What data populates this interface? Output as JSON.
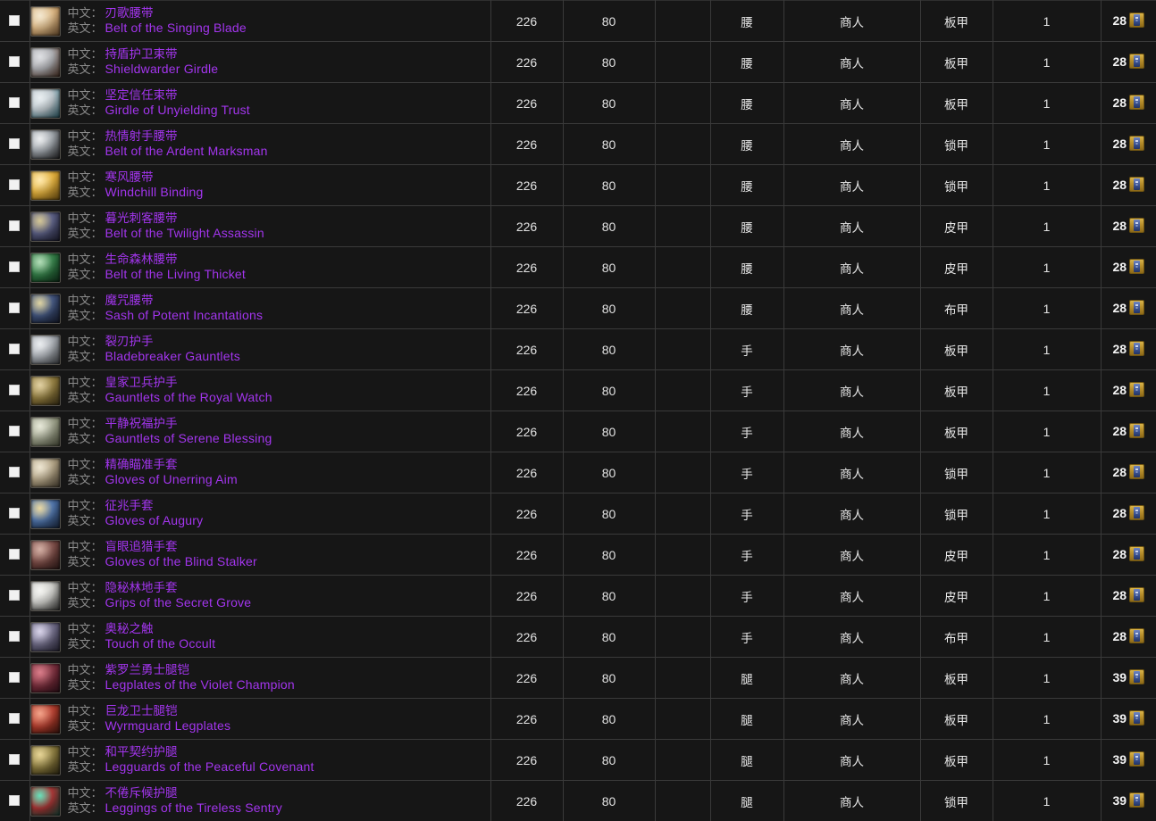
{
  "table": {
    "labels": {
      "zh_label": "中文：",
      "en_label": "英文：",
      "token_icon": "emblem-token-icon",
      "checkbox_icon": "checkbox-icon"
    },
    "columns": [
      "checkbox",
      "name",
      "item_level",
      "required_level",
      "blank",
      "slot",
      "source",
      "armor_type",
      "count",
      "cost"
    ],
    "rows": [
      {
        "zh": "刃歌腰带",
        "en": "Belt of the Singing Blade",
        "item_level": "226",
        "required_level": "80",
        "blank": "",
        "slot": "腰",
        "source": "商人",
        "armor": "板甲",
        "count": "1",
        "cost": "28",
        "icon_colors": [
          "#d9b582",
          "#8a6137",
          "#f0e2c4"
        ]
      },
      {
        "zh": "持盾护卫束带",
        "en": "Shieldwarder Girdle",
        "item_level": "226",
        "required_level": "80",
        "blank": "",
        "slot": "腰",
        "source": "商人",
        "armor": "板甲",
        "count": "1",
        "cost": "28",
        "icon_colors": [
          "#a8a9ad",
          "#5a3a2a",
          "#d6d8dc"
        ]
      },
      {
        "zh": "坚定信任束带",
        "en": "Girdle of Unyielding Trust",
        "item_level": "226",
        "required_level": "80",
        "blank": "",
        "slot": "腰",
        "source": "商人",
        "armor": "板甲",
        "count": "1",
        "cost": "28",
        "icon_colors": [
          "#b9c3c9",
          "#2e6a79",
          "#e3eaed"
        ]
      },
      {
        "zh": "热情射手腰带",
        "en": "Belt of the Ardent Marksman",
        "item_level": "226",
        "required_level": "80",
        "blank": "",
        "slot": "腰",
        "source": "商人",
        "armor": "锁甲",
        "count": "1",
        "cost": "28",
        "icon_colors": [
          "#9aa0a6",
          "#2a2a2c",
          "#e8eaec"
        ]
      },
      {
        "zh": "寒风腰带",
        "en": "Windchill Binding",
        "item_level": "226",
        "required_level": "80",
        "blank": "",
        "slot": "腰",
        "source": "商人",
        "armor": "锁甲",
        "count": "1",
        "cost": "28",
        "icon_colors": [
          "#e0ae3a",
          "#8d6414",
          "#ffe49a"
        ]
      },
      {
        "zh": "暮光刺客腰带",
        "en": "Belt of the Twilight Assassin",
        "item_level": "226",
        "required_level": "80",
        "blank": "",
        "slot": "腰",
        "source": "商人",
        "armor": "皮甲",
        "count": "1",
        "cost": "28",
        "icon_colors": [
          "#55597e",
          "#24243a",
          "#c9b87a"
        ]
      },
      {
        "zh": "生命森林腰带",
        "en": "Belt of the Living Thicket",
        "item_level": "226",
        "required_level": "80",
        "blank": "",
        "slot": "腰",
        "source": "商人",
        "armor": "皮甲",
        "count": "1",
        "cost": "28",
        "icon_colors": [
          "#2f7a43",
          "#12391f",
          "#9fd5a5"
        ]
      },
      {
        "zh": "魔咒腰带",
        "en": "Sash of Potent Incantations",
        "item_level": "226",
        "required_level": "80",
        "blank": "",
        "slot": "腰",
        "source": "商人",
        "armor": "布甲",
        "count": "1",
        "cost": "28",
        "icon_colors": [
          "#3c4f78",
          "#1b2136",
          "#d6c98a"
        ]
      },
      {
        "zh": "裂刃护手",
        "en": "Bladebreaker Gauntlets",
        "item_level": "226",
        "required_level": "80",
        "blank": "",
        "slot": "手",
        "source": "商人",
        "armor": "板甲",
        "count": "1",
        "cost": "28",
        "icon_colors": [
          "#a7acb2",
          "#4a4d52",
          "#e6e9ec"
        ]
      },
      {
        "zh": "皇家卫兵护手",
        "en": "Gauntlets of the Royal Watch",
        "item_level": "226",
        "required_level": "80",
        "blank": "",
        "slot": "手",
        "source": "商人",
        "armor": "板甲",
        "count": "1",
        "cost": "28",
        "icon_colors": [
          "#8f7a3c",
          "#4a3d1c",
          "#d9c489"
        ]
      },
      {
        "zh": "平静祝福护手",
        "en": "Gauntlets of Serene Blessing",
        "item_level": "226",
        "required_level": "80",
        "blank": "",
        "slot": "手",
        "source": "商人",
        "armor": "板甲",
        "count": "1",
        "cost": "28",
        "icon_colors": [
          "#9ca08a",
          "#5c6048",
          "#e1e3cf"
        ]
      },
      {
        "zh": "精确瞄准手套",
        "en": "Gloves of Unerring Aim",
        "item_level": "226",
        "required_level": "80",
        "blank": "",
        "slot": "手",
        "source": "商人",
        "armor": "锁甲",
        "count": "1",
        "cost": "28",
        "icon_colors": [
          "#b0a183",
          "#5e5340",
          "#e9dfc6"
        ]
      },
      {
        "zh": "征兆手套",
        "en": "Gloves of Augury",
        "item_level": "226",
        "required_level": "80",
        "blank": "",
        "slot": "手",
        "source": "商人",
        "armor": "锁甲",
        "count": "1",
        "cost": "28",
        "icon_colors": [
          "#4a6fa5",
          "#1f2f4c",
          "#e5cf8a"
        ]
      },
      {
        "zh": "盲眼追猎手套",
        "en": "Gloves of the Blind Stalker",
        "item_level": "226",
        "required_level": "80",
        "blank": "",
        "slot": "手",
        "source": "商人",
        "armor": "皮甲",
        "count": "1",
        "cost": "28",
        "icon_colors": [
          "#7a4a44",
          "#39201e",
          "#c89a8c"
        ]
      },
      {
        "zh": "隐秘林地手套",
        "en": "Grips of the Secret Grove",
        "item_level": "226",
        "required_level": "80",
        "blank": "",
        "slot": "手",
        "source": "商人",
        "armor": "皮甲",
        "count": "1",
        "cost": "28",
        "icon_colors": [
          "#c8c8c4",
          "#3a3a38",
          "#f2f2ee"
        ]
      },
      {
        "zh": "奥秘之触",
        "en": "Touch of the Occult",
        "item_level": "226",
        "required_level": "80",
        "blank": "",
        "slot": "手",
        "source": "商人",
        "armor": "布甲",
        "count": "1",
        "cost": "28",
        "icon_colors": [
          "#6e6a86",
          "#2f2c40",
          "#cfc9e4"
        ]
      },
      {
        "zh": "紫罗兰勇士腿铠",
        "en": "Legplates of the Violet Champion",
        "item_level": "226",
        "required_level": "80",
        "blank": "",
        "slot": "腿",
        "source": "商人",
        "armor": "板甲",
        "count": "1",
        "cost": "39",
        "icon_colors": [
          "#7a2c3a",
          "#3a1420",
          "#d05a6a"
        ]
      },
      {
        "zh": "巨龙卫士腿铠",
        "en": "Wyrmguard Legplates",
        "item_level": "226",
        "required_level": "80",
        "blank": "",
        "slot": "腿",
        "source": "商人",
        "armor": "板甲",
        "count": "1",
        "cost": "39",
        "icon_colors": [
          "#b23a2a",
          "#4a1a12",
          "#f08a6a"
        ]
      },
      {
        "zh": "和平契约护腿",
        "en": "Legguards of the Peaceful Covenant",
        "item_level": "226",
        "required_level": "80",
        "blank": "",
        "slot": "腿",
        "source": "商人",
        "armor": "板甲",
        "count": "1",
        "cost": "39",
        "icon_colors": [
          "#8a7a3c",
          "#3c3418",
          "#e0c97a"
        ]
      },
      {
        "zh": "不倦斥候护腿",
        "en": "Leggings of the Tireless Sentry",
        "item_level": "226",
        "required_level": "80",
        "blank": "",
        "slot": "腿",
        "source": "商人",
        "armor": "锁甲",
        "count": "1",
        "cost": "39",
        "icon_colors": [
          "#a02a2a",
          "#1a5a4a",
          "#3fd9a8"
        ]
      }
    ]
  }
}
